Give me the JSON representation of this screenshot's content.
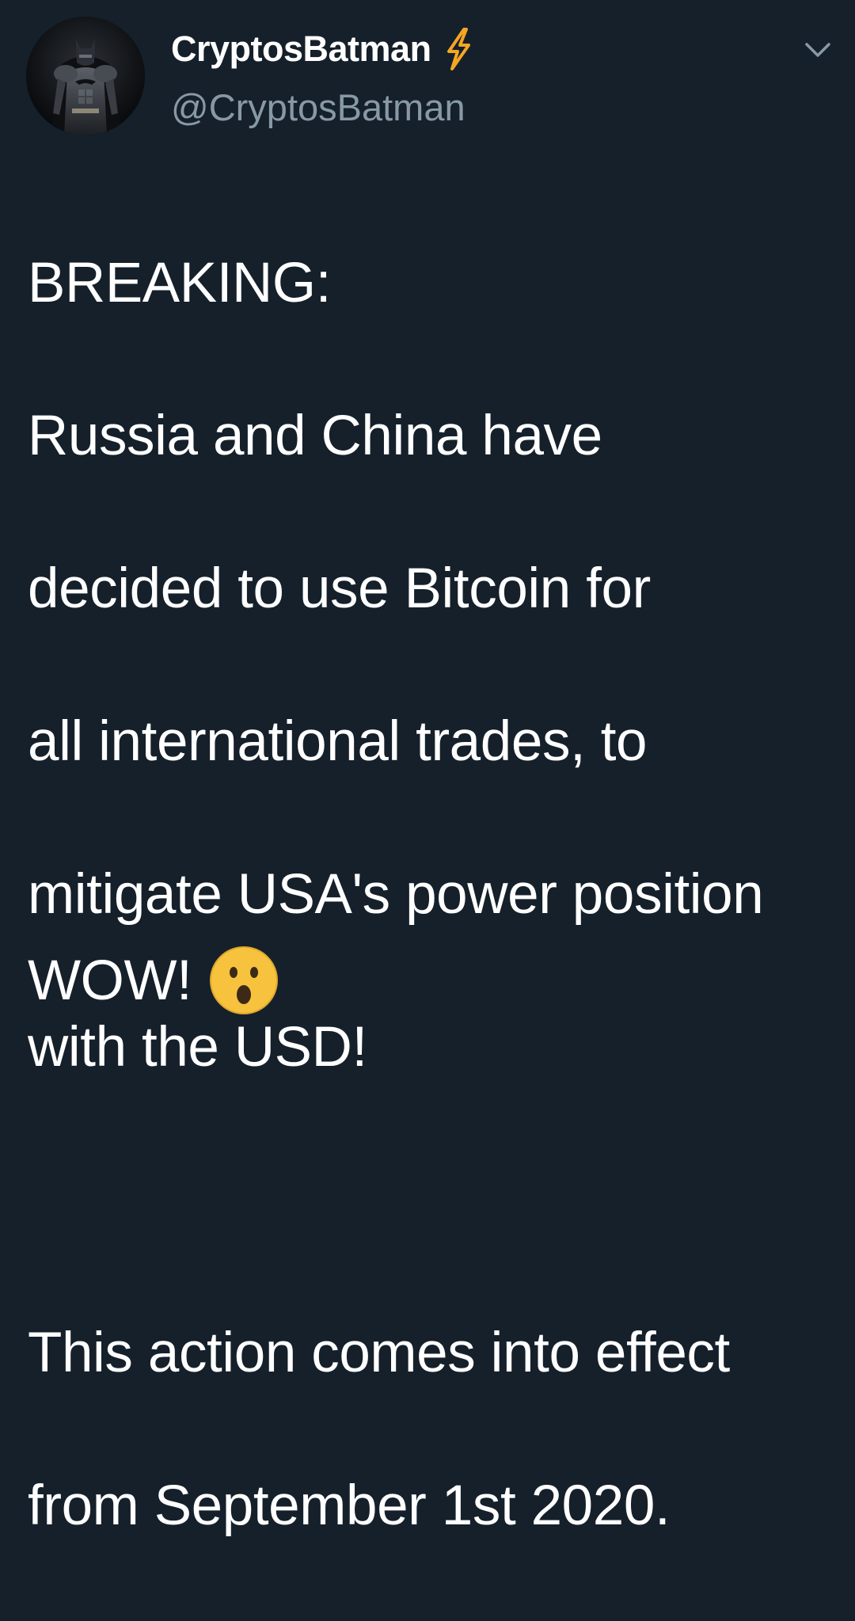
{
  "tweet": {
    "display_name": "CryptosBatman",
    "handle": "@CryptosBatman",
    "name_badge_icon": "lightning-bolt-icon",
    "menu_icon": "chevron-down-icon",
    "lines": [
      "BREAKING:",
      "Russia and China have",
      "decided to use Bitcoin for",
      "all international trades, to",
      "mitigate USA's power position",
      "with the USD!",
      "",
      "This action comes into effect",
      "from September 1st 2020.",
      ""
    ],
    "closing": "WOW!",
    "closing_emoji": "astonished-face-icon"
  },
  "colors": {
    "background": "#15202b",
    "text": "#ffffff",
    "secondary_text": "#8899a6",
    "bolt": "#f5a623",
    "emoji_face": "#f7c23d"
  }
}
